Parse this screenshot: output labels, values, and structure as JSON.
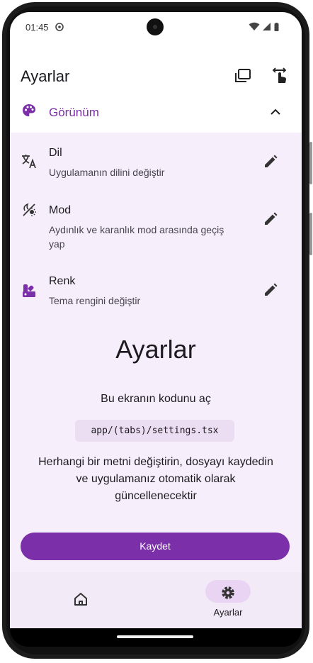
{
  "status_bar": {
    "time": "01:45",
    "icons": [
      "sync-icon",
      "wifi-icon",
      "signal-icon",
      "battery-icon"
    ]
  },
  "header": {
    "title": "Ayarlar",
    "actions": [
      "windows-icon",
      "touch-icon"
    ]
  },
  "section": {
    "title": "Görünüm",
    "icon": "palette-icon",
    "expanded": true
  },
  "settings": [
    {
      "name": "Dil",
      "description": "Uygulamanın dilini değiştir",
      "icon": "translate-icon"
    },
    {
      "name": "Mod",
      "description": "Aydınlık ve karanlık mod arasında geçiş yap",
      "icon": "theme-mode-icon"
    },
    {
      "name": "Renk",
      "description": "Tema rengini değiştir",
      "icon": "color-icon"
    }
  ],
  "main": {
    "title": "Ayarlar",
    "open_code_text": "Bu ekranın kodunu aç",
    "file_path": "app/(tabs)/settings.tsx",
    "hint": "Herhangi bir metni değiştirin, dosyayı kaydedin ve uygulamanız otomatik olarak güncellenecektir",
    "save_label": "Kaydet"
  },
  "bottom_nav": {
    "items": [
      {
        "label": "",
        "icon": "home-icon",
        "active": false
      },
      {
        "label": "Ayarlar",
        "icon": "gear-icon",
        "active": true
      }
    ]
  },
  "colors": {
    "accent": "#7b2fa8",
    "content_background": "#f6eefa",
    "nav_background": "#f3eaf7",
    "code_background": "#ecdef2"
  }
}
